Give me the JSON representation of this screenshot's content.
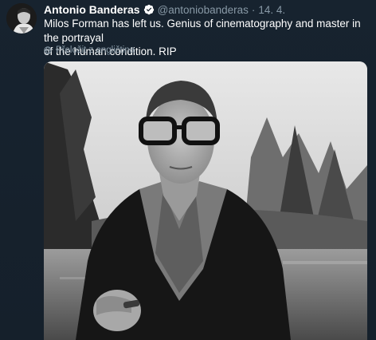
{
  "tweet": {
    "author_name": "Antonio Banderas",
    "verified_icon": "verified-badge-icon",
    "handle": "@antoniobanderas",
    "separator": "·",
    "date": "14. 4.",
    "text_line1": "Milos Forman has left us. Genius of cinematography and master in the portrayal",
    "text_line2": "of the human condition. RIP",
    "translate_label": "Přeložit z angličtina",
    "translate_icon": "globe-icon",
    "media_alt": "black-and-white portrait photo"
  },
  "colors": {
    "background": "#15202b",
    "primary_text": "#ffffff",
    "secondary_text": "#8899a6",
    "verified": "#ffffff"
  }
}
